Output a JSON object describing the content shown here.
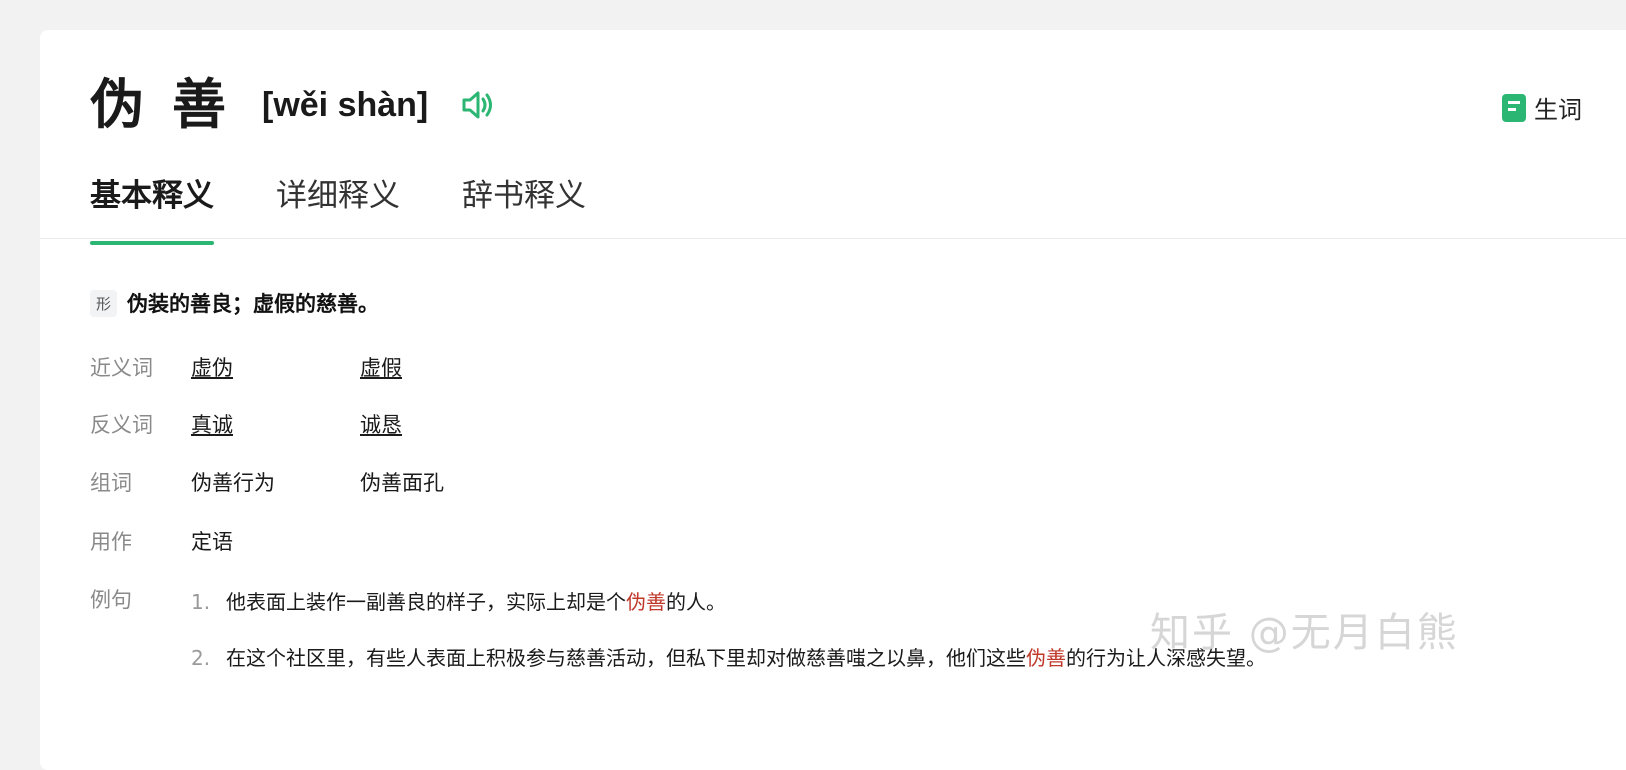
{
  "entry": {
    "word": "伪善",
    "pinyin": "[wěi shàn]",
    "vocab_label": "生词"
  },
  "tabs": [
    {
      "label": "基本释义"
    },
    {
      "label": "详细释义"
    },
    {
      "label": "辞书释义"
    }
  ],
  "definition": {
    "pos": "形",
    "text": "伪装的善良；虚假的慈善。"
  },
  "rows": {
    "synonyms": {
      "label": "近义词",
      "items": [
        "虚伪",
        "虚假"
      ]
    },
    "antonyms": {
      "label": "反义词",
      "items": [
        "真诚",
        "诚恳"
      ]
    },
    "compounds": {
      "label": "组词",
      "items": [
        "伪善行为",
        "伪善面孔"
      ]
    },
    "usage": {
      "label": "用作",
      "items": [
        "定语"
      ]
    },
    "examples": {
      "label": "例句",
      "items": [
        {
          "num": "1.",
          "before": "他表面上装作一副善良的样子，实际上却是个",
          "highlight": "伪善",
          "after": "的人。"
        },
        {
          "num": "2.",
          "before": "在这个社区里，有些人表面上积极参与慈善活动，但私下里却对做慈善嗤之以鼻，他们这些",
          "highlight": "伪善",
          "after": "的行为让人深感失望。"
        }
      ]
    }
  },
  "watermark": "知乎 @无月白熊",
  "colors": {
    "accent": "#2bb673",
    "highlight": "#c0392b"
  }
}
